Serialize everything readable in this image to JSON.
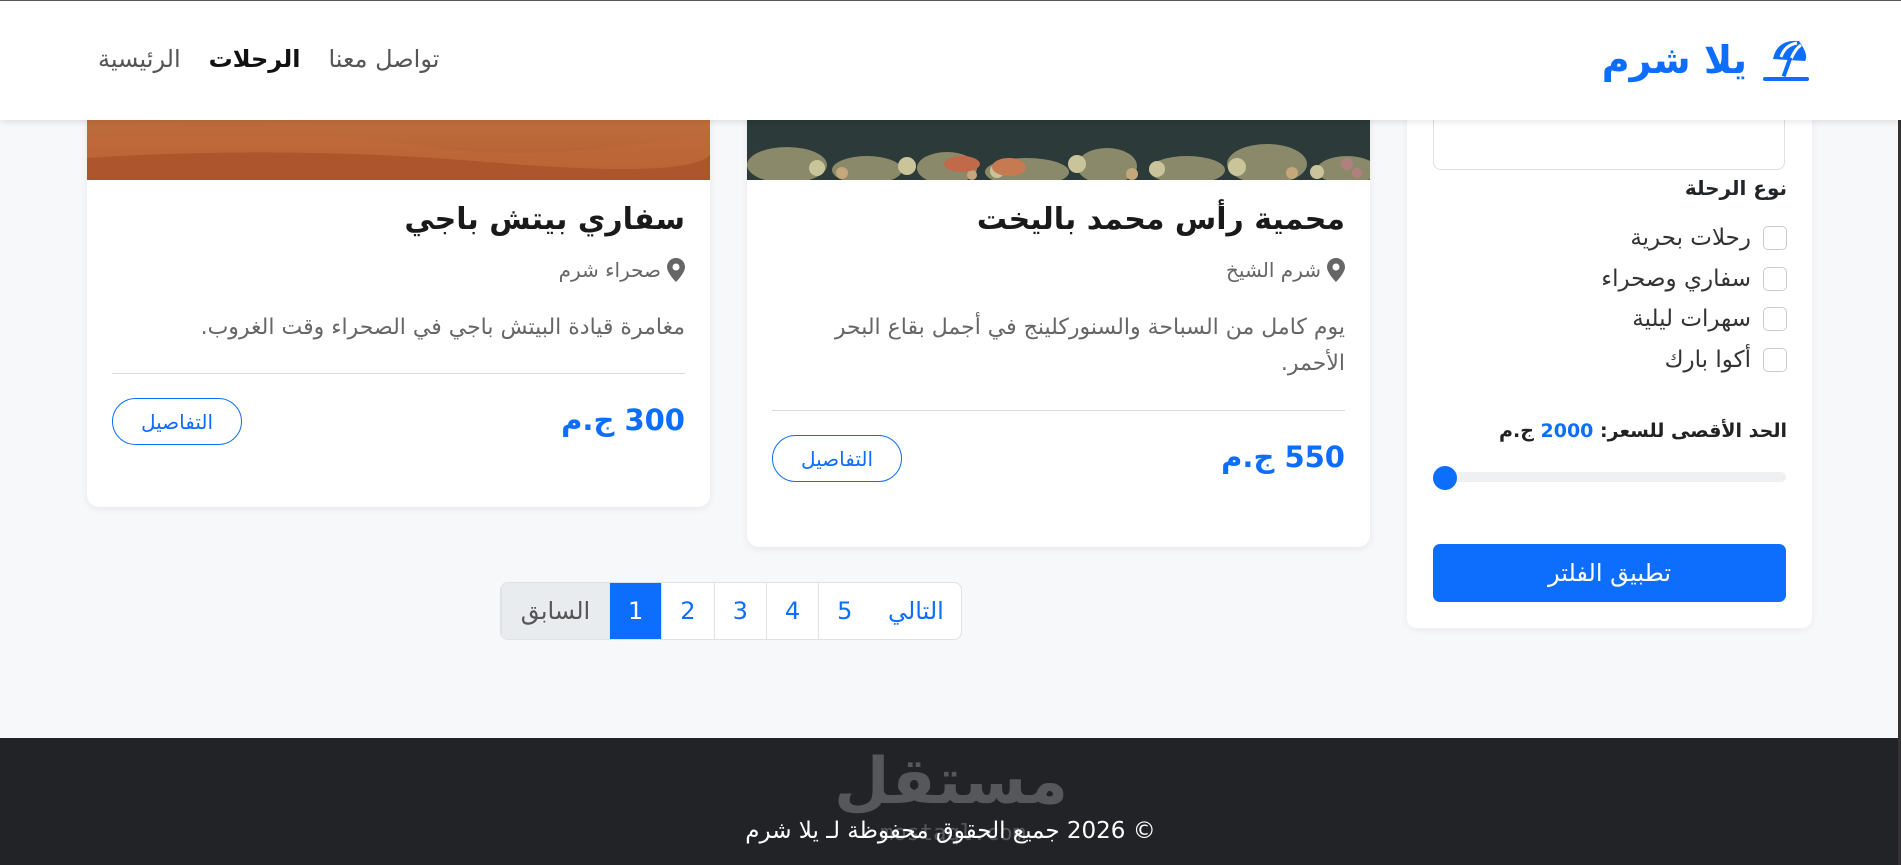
{
  "navbar": {
    "brand": "يلا شرم",
    "links": [
      {
        "label": "الرئيسية",
        "active": false
      },
      {
        "label": "الرحلات",
        "active": true
      },
      {
        "label": "تواصل معنا",
        "active": false
      }
    ]
  },
  "filters": {
    "trip_type_title": "نوع الرحلة",
    "trip_types": [
      "رحلات بحرية",
      "سفاري وصحراء",
      "سهرات ليلية",
      "أكوا بارك"
    ],
    "max_price_label": "الحد الأقصى للسعر:",
    "max_price_value": "2000",
    "max_price_currency": "ج.م",
    "slider_fraction": 0,
    "apply_label": "تطبيق الفلتر"
  },
  "cards": [
    {
      "title": "محمية رأس محمد باليخت",
      "location": "شرم الشيخ",
      "description": "يوم كامل من السباحة والسنوركلينج في أجمل بقاع البحر الأحمر.",
      "price": "550 ج.م",
      "details_label": "التفاصيل"
    },
    {
      "title": "سفاري بيتش باجي",
      "location": "صحراء شرم",
      "description": "مغامرة قيادة البيتش باجي في الصحراء وقت الغروب.",
      "price": "300 ج.م",
      "details_label": "التفاصيل"
    }
  ],
  "pagination": {
    "prev": "السابق",
    "pages": [
      "1",
      "2",
      "3",
      "4",
      "5"
    ],
    "active_page": "1",
    "next": "التالي"
  },
  "footer": {
    "copyright": "© 2026 جميع الحقوق محفوظة لـ يلا شرم",
    "watermark": "مستقل",
    "watermark_sub": "mostaql.com"
  },
  "colors": {
    "accent": "#0d6efd",
    "footer_bg": "#222326",
    "page_bg": "#f7f8fa"
  }
}
